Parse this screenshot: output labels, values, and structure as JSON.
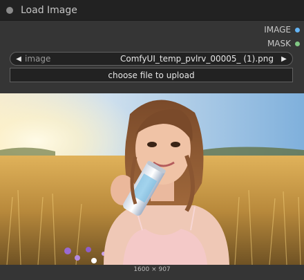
{
  "node": {
    "title": "Load Image"
  },
  "outputs": [
    {
      "label": "IMAGE",
      "color": "#64b5f6"
    },
    {
      "label": "MASK",
      "color": "#81c784"
    }
  ],
  "image_widget": {
    "label": "image",
    "value": "ComfyUI_temp_pvlrv_00005_ (1).png",
    "left_arrow": "◀",
    "right_arrow": "▶"
  },
  "upload_button": {
    "label": "choose file to upload"
  },
  "preview": {
    "dimensions": "1600 × 907"
  }
}
